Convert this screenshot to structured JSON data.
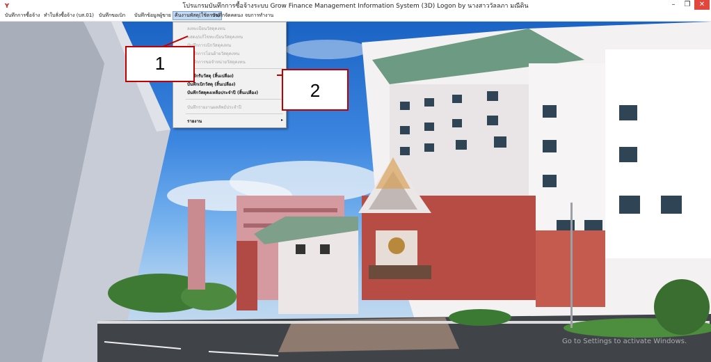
{
  "window": {
    "title": "โปรแกรมบันทึกการซื้อจ้างระบบ  Grow Finance Management Information System (3D) Logon by นางสาววัลลภา มณีดิน",
    "app_icon": "ʏ",
    "minimize_label": "–",
    "maximize_label": "❐",
    "close_label": "✕"
  },
  "menubar": {
    "items": [
      {
        "label": "บันทึกการซื้อจ้าง"
      },
      {
        "label": "ทำใบสั่งซื้อจ้าง (บส.01)"
      },
      {
        "label": "บันทึกขอเบิก"
      },
      {
        "label": "บันทึกข้อมูลผู้ขาย"
      },
      {
        "label": "คืนงานพัสดุ(ใช้ตรวจ)",
        "active": true
      },
      {
        "label": "บันทึกจัดคดนง"
      },
      {
        "label": "จบการทำงาน"
      }
    ]
  },
  "dropdown": {
    "items": [
      {
        "label": "ลงทะเบียนวัสดุคงทน",
        "enabled": false
      },
      {
        "label": "แสดง/แก้ไขทะเบียนวัสดุคงทน",
        "enabled": false
      },
      {
        "label": "บันทึกการเบิกวัสดุคงทน",
        "enabled": false
      },
      {
        "label": "บันทึกการโอนย้ายวัสดุคงทน",
        "enabled": false
      },
      {
        "label": "บันทึกการขอจำหน่ายวัสดุคงทน",
        "enabled": false
      },
      {
        "label": "บันทึกรับวัสดุ (สิ้นเปลือง)",
        "enabled": true
      },
      {
        "label": "บันทึกเบิกวัสดุ (สิ้นเปลือง)",
        "enabled": true
      },
      {
        "label": "บันทึกวัสดุคงเหลือประจำปี (สิ้นเปลือง)",
        "enabled": true
      },
      {
        "label": "บันทึกรายงานผลลัพธ์ประจำปี",
        "enabled": false
      },
      {
        "label": "รายงาน",
        "enabled": true,
        "submenu_arrow": "▸"
      }
    ]
  },
  "callouts": [
    {
      "number": "1"
    },
    {
      "number": "2"
    }
  ],
  "watermark": "Go to Settings to activate Windows.",
  "colors": {
    "accent_red": "#c00000",
    "close_button": "#e2473d",
    "menu_highlight": "#c4d9f2"
  }
}
